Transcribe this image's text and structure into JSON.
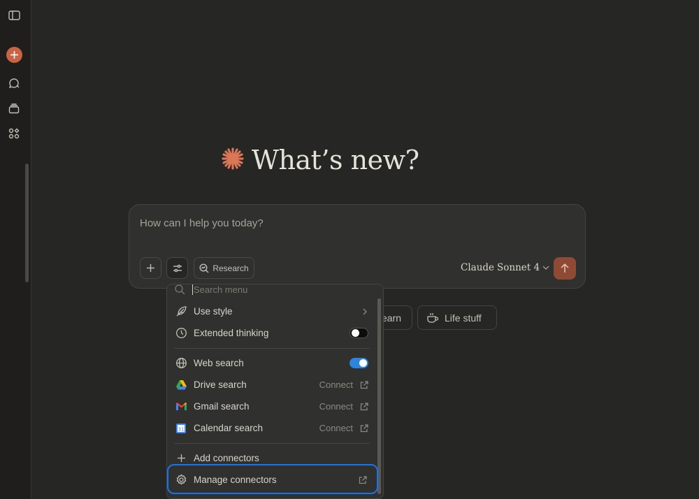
{
  "heading": {
    "title": "What’s new?"
  },
  "prompt": {
    "placeholder": "How can I help you today?"
  },
  "toolbar": {
    "research_label": "Research"
  },
  "model": {
    "brand": "Claude",
    "name": "Sonnet 4"
  },
  "chips": [
    {
      "label": "earn"
    },
    {
      "label": "Life stuff"
    }
  ],
  "menu": {
    "search_placeholder": "Search menu",
    "items": [
      {
        "label": "Use style"
      },
      {
        "label": "Extended thinking",
        "toggle": "off"
      },
      {
        "label": "Web search",
        "toggle": "on"
      },
      {
        "label": "Drive search",
        "action": "Connect"
      },
      {
        "label": "Gmail search",
        "action": "Connect"
      },
      {
        "label": "Calendar search",
        "action": "Connect"
      },
      {
        "label": "Add connectors"
      },
      {
        "label": "Manage connectors"
      }
    ]
  },
  "colors": {
    "accent": "#c96442",
    "toggle_on": "#2c84db",
    "highlight": "#1a73e8"
  }
}
